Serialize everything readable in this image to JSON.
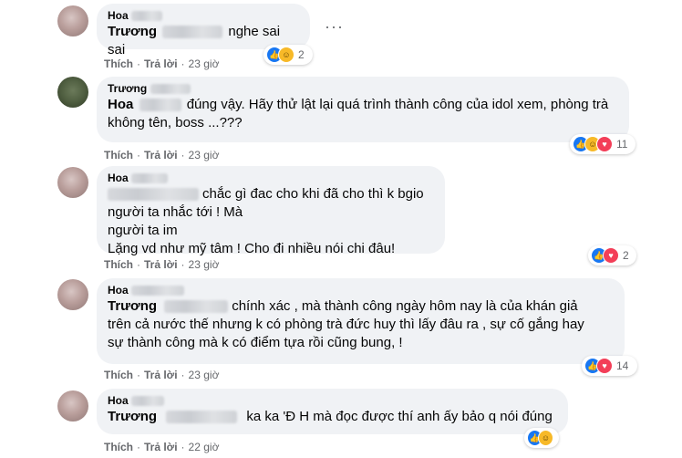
{
  "comments": [
    {
      "author": "Hoa",
      "mention": "Trương",
      "text": "nghe sai sai",
      "actions": {
        "like": "Thích",
        "reply": "Trả lời",
        "time": "23 giờ"
      },
      "reaction_count": "2",
      "reactions": [
        "like-icon",
        "haha-icon"
      ]
    },
    {
      "author": "Trương",
      "mention": "Hoa",
      "text": "đúng vậy. Hãy thử lật lại quá trình thành công của idol xem, phòng trà không tên, boss ...???",
      "actions": {
        "like": "Thích",
        "reply": "Trả lời",
        "time": "23 giờ"
      },
      "reaction_count": "11",
      "reactions": [
        "like-icon",
        "haha-icon",
        "heart-icon"
      ]
    },
    {
      "author": "Hoa",
      "text_line1": "chắc gì đac cho khi đã cho thì k bgio người ta nhắc tới ! Mà",
      "text_line2": "người ta im",
      "text_line3": "Lặng vd như mỹ tâm ! Cho đi nhiều nói chi đâu!",
      "actions": {
        "like": "Thích",
        "reply": "Trả lời",
        "time": "23 giờ"
      },
      "reaction_count": "2",
      "reactions": [
        "like-icon",
        "heart-icon"
      ]
    },
    {
      "author": "Hoa",
      "mention": "Trương",
      "text_line1": "chính xác , mà thành công ngày hôm nay là của khán giả",
      "text_line2": "trên cả nước thế nhưng k có phòng trà đức huy thì lấy đâu ra , sự cố gắng hay",
      "text_line3": "sự thành công mà k có điểm tựa rồi cũng bung, !",
      "actions": {
        "like": "Thích",
        "reply": "Trả lời",
        "time": "23 giờ"
      },
      "reaction_count": "14",
      "reactions": [
        "like-icon",
        "heart-icon"
      ]
    },
    {
      "author": "Hoa",
      "mention": "Trương",
      "text": "ka ka 'Đ H mà đọc được thí anh ấy bảo q nói đúng",
      "actions": {
        "like": "Thích",
        "reply": "Trả lời",
        "time": "22 giờ"
      },
      "reactions": [
        "like-icon",
        "haha-icon"
      ]
    }
  ],
  "more_icon": "more-options-icon",
  "colors": {
    "bubble": "#f0f2f5",
    "meta": "#65676b",
    "like": "#1877f2",
    "haha": "#f7b928",
    "heart": "#f33e58"
  }
}
